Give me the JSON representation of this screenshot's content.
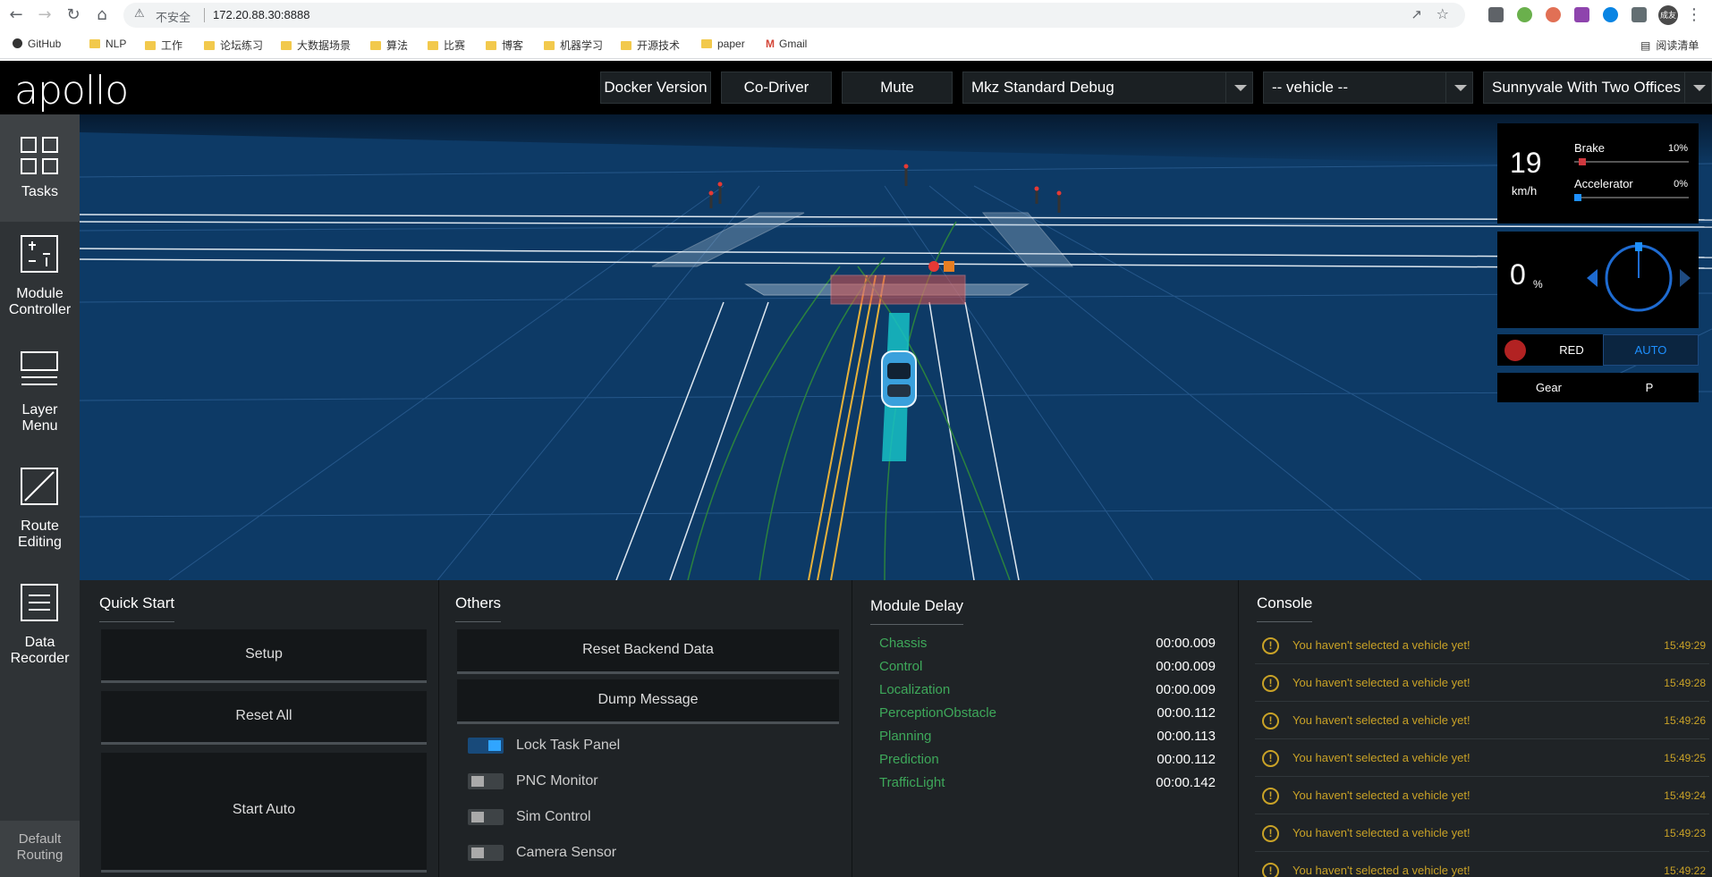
{
  "browser": {
    "insecure_label": "不安全",
    "url": "172.20.88.30:8888",
    "profile_label": "成友",
    "reading_list": "阅读清单",
    "bookmarks": [
      "GitHub",
      "NLP",
      "工作",
      "论坛练习",
      "大数据场景",
      "算法",
      "比赛",
      "博客",
      "机器学习",
      "开源技术",
      "paper",
      "Gmail"
    ]
  },
  "app": {
    "logo": "apollo",
    "buttons": {
      "docker": "Docker Version",
      "codriver": "Co-Driver",
      "mute": "Mute"
    },
    "selects": {
      "mode": "Mkz Standard Debug",
      "vehicle": "-- vehicle --",
      "map": "Sunnyvale With Two Offices"
    }
  },
  "sidebar": {
    "items": [
      {
        "label1": "Tasks",
        "label2": ""
      },
      {
        "label1": "Module",
        "label2": "Controller"
      },
      {
        "label1": "Layer",
        "label2": "Menu"
      },
      {
        "label1": "Route",
        "label2": "Editing"
      },
      {
        "label1": "Data",
        "label2": "Recorder"
      }
    ],
    "default_routing": {
      "label1": "Default",
      "label2": "Routing"
    }
  },
  "dashboard": {
    "speed": "19",
    "speed_unit": "km/h",
    "brake_label": "Brake",
    "brake_value": "10%",
    "brake_fraction": 0.1,
    "accel_label": "Accelerator",
    "accel_value": "0%",
    "accel_fraction": 0.0,
    "steering": "0",
    "steering_unit": "%",
    "signal_state": "RED",
    "driving_mode": "AUTO",
    "gear_label": "Gear",
    "gear_value": "P"
  },
  "quick_start": {
    "title": "Quick Start",
    "buttons": [
      "Setup",
      "Reset All",
      "Start Auto"
    ]
  },
  "others": {
    "title": "Others",
    "buttons": [
      "Reset Backend Data",
      "Dump Message"
    ],
    "toggles": [
      {
        "label": "Lock Task Panel",
        "on": true
      },
      {
        "label": "PNC Monitor",
        "on": false
      },
      {
        "label": "Sim Control",
        "on": false
      },
      {
        "label": "Camera Sensor",
        "on": false
      }
    ]
  },
  "module_delay": {
    "title": "Module Delay",
    "rows": [
      {
        "name": "Chassis",
        "value": "00:00.009"
      },
      {
        "name": "Control",
        "value": "00:00.009"
      },
      {
        "name": "Localization",
        "value": "00:00.009"
      },
      {
        "name": "PerceptionObstacle",
        "value": "00:00.112"
      },
      {
        "name": "Planning",
        "value": "00:00.113"
      },
      {
        "name": "Prediction",
        "value": "00:00.112"
      },
      {
        "name": "TrafficLight",
        "value": "00:00.142"
      }
    ]
  },
  "console": {
    "title": "Console",
    "rows": [
      {
        "msg": "You haven't selected a vehicle yet!",
        "time": "15:49:29"
      },
      {
        "msg": "You haven't selected a vehicle yet!",
        "time": "15:49:28"
      },
      {
        "msg": "You haven't selected a vehicle yet!",
        "time": "15:49:26"
      },
      {
        "msg": "You haven't selected a vehicle yet!",
        "time": "15:49:25"
      },
      {
        "msg": "You haven't selected a vehicle yet!",
        "time": "15:49:24"
      },
      {
        "msg": "You haven't selected a vehicle yet!",
        "time": "15:49:23"
      },
      {
        "msg": "You haven't selected a vehicle yet!",
        "time": "15:49:22"
      }
    ]
  },
  "colors": {
    "scene_bg": "#0d3a66",
    "accent_blue": "#1e90ff",
    "delay_green": "#3ea85a",
    "warning_yellow": "#c9a227",
    "signal_red": "#b22222"
  }
}
